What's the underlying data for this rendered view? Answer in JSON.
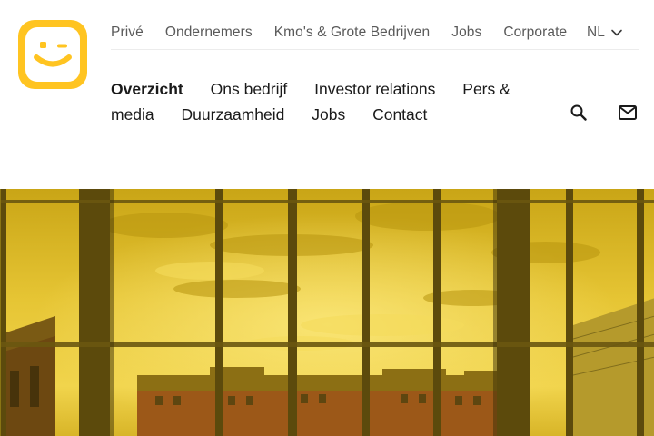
{
  "brand": {
    "logo_name": "telenet-logo",
    "color": "#FFC421"
  },
  "top_nav": {
    "items": [
      {
        "label": "Privé"
      },
      {
        "label": "Ondernemers"
      },
      {
        "label": "Kmo's & Grote Bedrijven"
      },
      {
        "label": "Jobs"
      },
      {
        "label": "Corporate"
      }
    ],
    "language": {
      "label": "NL",
      "icon": "chevron-down-icon"
    }
  },
  "main_nav": {
    "items": [
      {
        "label": "Overzicht",
        "active": true
      },
      {
        "label": "Ons bedrijf",
        "active": false
      },
      {
        "label": "Investor relations",
        "active": false
      },
      {
        "label": "Pers & media",
        "active": false
      },
      {
        "label": "Duurzaamheid",
        "active": false
      },
      {
        "label": "Jobs",
        "active": false
      },
      {
        "label": "Contact",
        "active": false
      }
    ]
  },
  "actions": {
    "search_icon": "search-icon",
    "mail_icon": "mail-icon"
  },
  "hero": {
    "image": "yellow-tinted-window-view",
    "tint_color": "#E8C21E"
  }
}
